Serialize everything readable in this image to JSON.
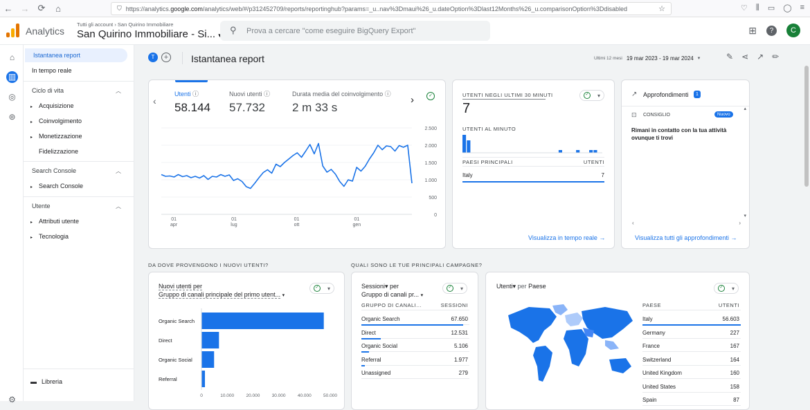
{
  "browser": {
    "url_prefix": "https://analytics.",
    "url_domain": "google.com",
    "url_rest": "/analytics/web/#/p312452709/reports/reportinghub?params=_u..nav%3Dmaui%26_u.dateOption%3Dlast12Months%26_u.comparisonOption%3Ddisabled"
  },
  "header": {
    "app_name": "Analytics",
    "account_crumb": "Tutti gli account  ›  San Quirino Immobiliare",
    "property_name": "San Quirino Immobiliare - Si...",
    "search_placeholder": "Prova a cercare \"come eseguire BigQuery Export\"",
    "avatar_letter": "C"
  },
  "sidebar": {
    "items": [
      {
        "label": "Istantanea report"
      },
      {
        "label": "In tempo reale"
      }
    ],
    "sections": [
      {
        "label": "Ciclo di vita",
        "children": [
          "Acquisizione",
          "Coinvolgimento",
          "Monetizzazione",
          "Fidelizzazione"
        ]
      },
      {
        "label": "Search Console",
        "children": [
          "Search Console"
        ]
      },
      {
        "label": "Utente",
        "children": [
          "Attributi utente",
          "Tecnologia"
        ]
      }
    ],
    "library": "Libreria"
  },
  "page": {
    "title": "Istantanea report",
    "badge": "T",
    "date_small": "Ultimi 12 mesi",
    "date_range": "19 mar 2023 - 19 mar 2024"
  },
  "metrics": [
    {
      "label": "Utenti",
      "value": "58.144"
    },
    {
      "label": "Nuovi utenti",
      "value": "57.732"
    },
    {
      "label": "Durata media del coinvolgimento",
      "value": "2 m 33 s"
    }
  ],
  "chart_data": [
    {
      "type": "line",
      "x_ticks": [
        "01\napr",
        "01\nlug",
        "01\nott",
        "01\ngen"
      ],
      "y_ticks": [
        "2.500",
        "2.000",
        "1.500",
        "1.000",
        "500",
        "0"
      ],
      "ylim": [
        0,
        2500
      ],
      "series": [
        {
          "values": [
            1150,
            1100,
            1110,
            1080,
            1150,
            1090,
            1120,
            1060,
            1100,
            1050,
            1120,
            1010,
            1100,
            1080,
            1150,
            1100,
            1140,
            980,
            1030,
            950,
            800,
            750,
            900,
            1060,
            1210,
            1290,
            1190,
            1450,
            1380,
            1500,
            1600,
            1700,
            1780,
            1650,
            1830,
            2020,
            1750,
            2050,
            1400,
            1220,
            1300,
            1160,
            950,
            810,
            1000,
            960,
            1360,
            1250,
            1390,
            1600,
            1780,
            2000,
            1870,
            1980,
            1960,
            1830,
            1990,
            1940,
            2000,
            900
          ]
        }
      ]
    },
    {
      "type": "bar",
      "values": [
        13,
        9,
        0,
        0,
        0,
        0,
        0,
        0,
        0,
        0,
        0,
        0,
        0,
        0,
        0,
        0,
        0,
        0,
        0,
        0,
        0,
        0,
        2,
        0,
        0,
        0,
        2,
        0,
        0,
        2,
        2,
        0
      ]
    },
    {
      "type": "bar",
      "title": "Nuovi utenti per Gruppo di canali principale del primo utent...",
      "categories": [
        "Organic Search",
        "Direct",
        "Organic Social",
        "Referral"
      ],
      "values": [
        47500,
        6800,
        4900,
        1350
      ],
      "x_ticks": [
        "0",
        "10.000",
        "20.000",
        "30.000",
        "40.000",
        "50.000"
      ],
      "xlim": [
        0,
        50000
      ]
    }
  ],
  "realtime": {
    "users_label": "UTENTI NEGLI ULTIMI 30 MINUTI",
    "users_value": "7",
    "per_minute_label": "UTENTI AL MINUTO",
    "countries_label": "PAESI PRINCIPALI",
    "countries_col": "UTENTI",
    "rows": [
      {
        "name": "Italy",
        "value": "7"
      }
    ],
    "link": "Visualizza in tempo reale"
  },
  "insights": {
    "title": "Approfondimenti",
    "count": "1",
    "tag": "CONSIGLIO",
    "new_badge": "Nuovo",
    "text": "Rimani in contatto con la tua attività ovunque ti trovi",
    "link": "Visualizza tutti gli approfondimenti"
  },
  "sections": {
    "where_from": "DA DOVE PROVENGONO I NUOVI UTENTI?",
    "campaigns": "QUALI SONO LE TUE PRINCIPALI CAMPAGNE?"
  },
  "new_users_card": {
    "title_line1": "Nuovi utenti per",
    "title_line2": "Gruppo di canali principale del primo utent..."
  },
  "sessions_card": {
    "title_line1": "Sessioni▾ per",
    "title_line2": "Gruppo di canali pr...",
    "col1": "GRUPPO DI CANALI...",
    "col2": "SESSIONI",
    "rows": [
      {
        "name": "Organic Search",
        "value": "67.650",
        "share": 0.94
      },
      {
        "name": "Direct",
        "value": "12.531",
        "share": 0.18
      },
      {
        "name": "Organic Social",
        "value": "5.106",
        "share": 0.07
      },
      {
        "name": "Referral",
        "value": "1.977",
        "share": 0.03
      },
      {
        "name": "Unassigned",
        "value": "279",
        "share": 0.0
      }
    ]
  },
  "country_card": {
    "title_a": "Utenti▾",
    "title_b": "per",
    "title_c": "Paese",
    "col1": "PAESE",
    "col2": "UTENTI",
    "rows": [
      {
        "name": "Italy",
        "value": "56.603"
      },
      {
        "name": "Germany",
        "value": "227"
      },
      {
        "name": "France",
        "value": "167"
      },
      {
        "name": "Switzerland",
        "value": "164"
      },
      {
        "name": "United Kingdom",
        "value": "160"
      },
      {
        "name": "United States",
        "value": "158"
      },
      {
        "name": "Spain",
        "value": "87"
      }
    ]
  },
  "colors": {
    "accent": "#1a73e8",
    "check": "#188038"
  }
}
